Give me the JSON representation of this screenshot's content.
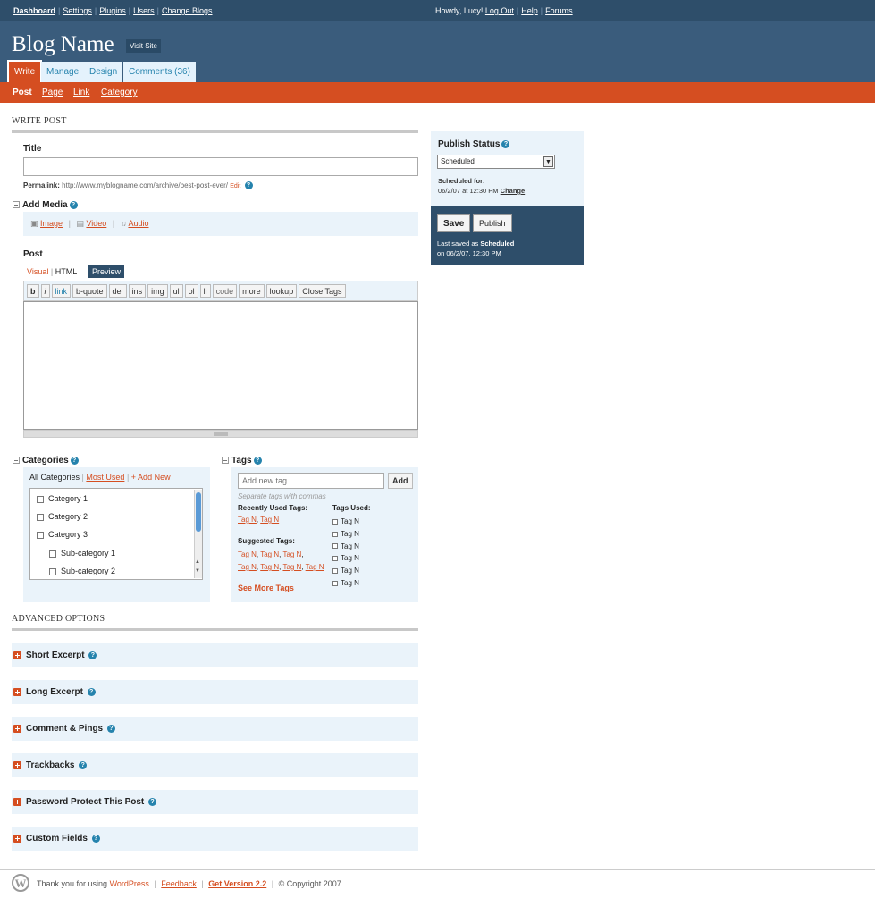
{
  "topnav": {
    "items": [
      {
        "label": "Dashboard",
        "bold": true
      },
      {
        "label": "Settings"
      },
      {
        "label": "Plugins"
      },
      {
        "label": "Users"
      },
      {
        "label": "Change Blogs"
      }
    ],
    "howdy": "Howdy, Lucy!",
    "logout": "Log Out",
    "help": "Help",
    "forums": "Forums"
  },
  "masthead": {
    "blog_name": "Blog Name",
    "visit_site": "Visit Site"
  },
  "tabs": [
    "Write",
    "Manage",
    "Design",
    "Comments (36)"
  ],
  "subnav": [
    "Post",
    "Page",
    "Link",
    "Category"
  ],
  "write_post": {
    "heading": "WRITE POST",
    "title_label": "Title",
    "title_value": "",
    "permalink_label": "Permalink:",
    "permalink_url": "http://www.myblogname.com/archive/best-post-ever/",
    "permalink_edit": "Edit"
  },
  "add_media": {
    "label": "Add Media",
    "image": "Image",
    "video": "Video",
    "audio": "Audio"
  },
  "post": {
    "label": "Post",
    "visual": "Visual",
    "html": "HTML",
    "preview": "Preview",
    "buttons": [
      "b",
      "i",
      "link",
      "b-quote",
      "del",
      "ins",
      "img",
      "ul",
      "ol",
      "li",
      "code",
      "more",
      "lookup",
      "Close Tags"
    ]
  },
  "categories": {
    "label": "Categories",
    "all": "All Categories",
    "most_used": "Most Used",
    "add_new": "+ Add New",
    "items": [
      "Category 1",
      "Category 2",
      "Category 3"
    ],
    "sub_items": [
      "Sub-category 1",
      "Sub-category 2"
    ]
  },
  "tags": {
    "label": "Tags",
    "placeholder": "Add new tag",
    "add": "Add",
    "hint": "Separate tags with commas",
    "recent_label": "Recently Used Tags:",
    "recent": "Tag N",
    "suggested_label": "Suggested Tags:",
    "suggested": "Tag N",
    "used_label": "Tags Used:",
    "used": [
      "Tag N",
      "Tag N",
      "Tag N",
      "Tag N",
      "Tag N",
      "Tag N"
    ],
    "see_more": "See More Tags"
  },
  "publish": {
    "label": "Publish Status",
    "status": "Scheduled",
    "scheduled_for": "Scheduled for:",
    "scheduled_date": "06/2/07 at 12:30 PM",
    "change": "Change",
    "save": "Save",
    "publish": "Publish",
    "last_saved_prefix": "Last saved as",
    "last_saved_status": "Scheduled",
    "last_saved_date": "on 06/2/07, 12:30 PM"
  },
  "advanced": {
    "heading": "ADVANCED OPTIONS",
    "items": [
      "Short Excerpt",
      "Long Excerpt",
      "Comment & Pings",
      "Trackbacks",
      "Password Protect This Post",
      "Custom Fields"
    ]
  },
  "footer": {
    "thanks": "Thank you for using",
    "wordpress": "WordPress",
    "feedback": "Feedback",
    "get_version": "Get Version 2.2",
    "copyright": "© Copyright 2007"
  },
  "colors": {
    "header_dark": "#2e4e6a",
    "header": "#3a5c7c",
    "accent": "#d54e21",
    "panel": "#eaf3fa",
    "link_blue": "#2583ad"
  }
}
